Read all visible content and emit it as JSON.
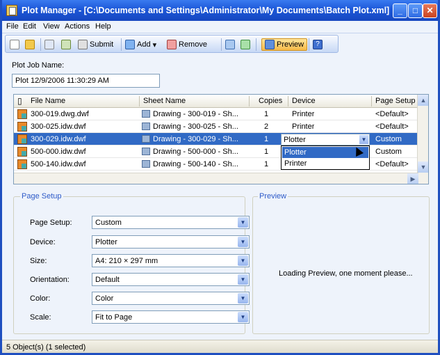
{
  "window": {
    "title": "Plot Manager - [C:\\Documents and Settings\\Administrator\\My Documents\\Batch Plot.xml]"
  },
  "menu": [
    "File",
    "Edit",
    "View",
    "Actions",
    "Help"
  ],
  "toolbar": {
    "submit_label": "Submit",
    "add_label": "Add",
    "remove_label": "Remove",
    "preview_label": "Preview"
  },
  "job": {
    "label": "Plot Job Name:",
    "value": "Plot 12/9/2006 11:30:29 AM"
  },
  "grid": {
    "columns": [
      "File Name",
      "Sheet Name",
      "Copies",
      "Device",
      "Page Setup"
    ],
    "rows": [
      {
        "file": "300-019.dwg.dwf",
        "sheet": "Drawing - 300-019 - Sh...",
        "copies": "1",
        "device": "Printer",
        "page_setup": "<Default>"
      },
      {
        "file": "300-025.idw.dwf",
        "sheet": "Drawing - 300-025 - Sh...",
        "copies": "2",
        "device": "Printer",
        "page_setup": "<Default>"
      },
      {
        "file": "300-029.idw.dwf",
        "sheet": "Drawing - 300-029 - Sh...",
        "copies": "1",
        "device": "Plotter",
        "page_setup": "Custom"
      },
      {
        "file": "500-000.idw.dwf",
        "sheet": "Drawing - 500-000 - Sh...",
        "copies": "1",
        "device": "",
        "page_setup": "Custom"
      },
      {
        "file": "500-140.idw.dwf",
        "sheet": "Drawing - 500-140 - Sh...",
        "copies": "1",
        "device": "",
        "page_setup": "<Default>"
      }
    ],
    "dropdown_value": "Plotter",
    "dropdown_options": [
      "Plotter",
      "Printer"
    ]
  },
  "page_setup": {
    "group_label": "Page Setup",
    "fields": [
      {
        "label": "Page Setup:",
        "value": "Custom"
      },
      {
        "label": "Device:",
        "value": "Plotter"
      },
      {
        "label": "Size:",
        "value": "A4: 210 × 297 mm"
      },
      {
        "label": "Orientation:",
        "value": "Default"
      },
      {
        "label": "Color:",
        "value": "Color"
      },
      {
        "label": "Scale:",
        "value": "Fit to Page"
      }
    ]
  },
  "preview": {
    "group_label": "Preview",
    "message": "Loading Preview, one moment please..."
  },
  "status": {
    "text": "5 Object(s) (1 selected)"
  }
}
